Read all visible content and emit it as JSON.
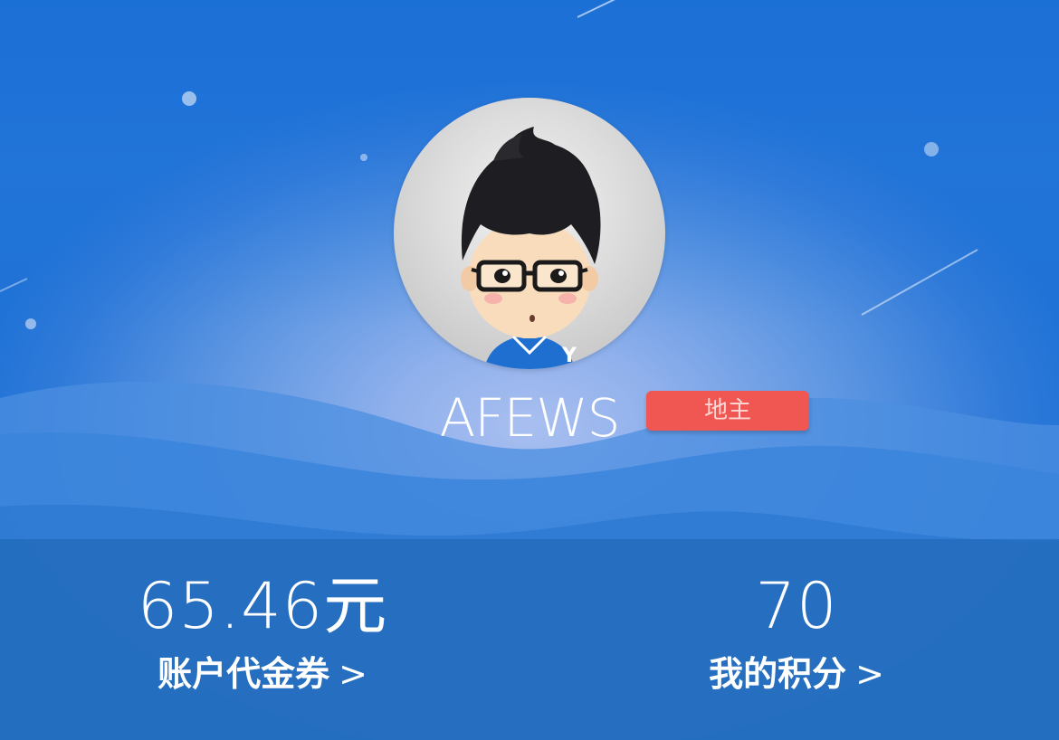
{
  "profile": {
    "username": "AFEWS",
    "role_badge": "地主"
  },
  "stats": {
    "voucher": {
      "value": "65.46元",
      "label": "账户代金券",
      "chevron": ">"
    },
    "points": {
      "value": "70",
      "label": "我的积分",
      "chevron": ">"
    }
  },
  "colors": {
    "background_accent": "#1f72d6",
    "badge": "#f05652",
    "stats_bar": "#2a6fbf"
  },
  "icons": [
    "avatar-cartoon-boy",
    "chevron-right-icon"
  ]
}
